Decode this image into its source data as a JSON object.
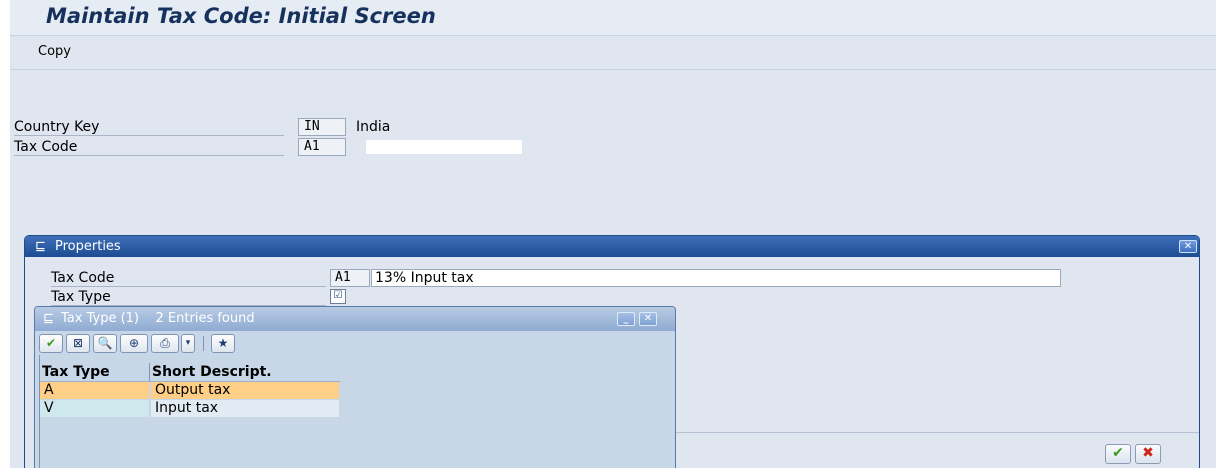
{
  "screen": {
    "title": "Maintain Tax Code: Initial Screen",
    "toolbar": {
      "copy_label": "Copy"
    },
    "fields": {
      "country_key": {
        "label": "Country Key",
        "value": "IN",
        "description": "India"
      },
      "tax_code": {
        "label": "Tax Code",
        "value": "A1",
        "description": ""
      }
    }
  },
  "properties_dialog": {
    "title": "Properties",
    "tax_code": {
      "label": "Tax Code",
      "value": "A1",
      "description": "13% Input tax"
    },
    "tax_type": {
      "label": "Tax Type",
      "value": ""
    }
  },
  "taxtype_popup": {
    "title": "Tax Type (1)",
    "entries_found": "2 Entries found",
    "columns": [
      "Tax Type",
      "Short Descript."
    ],
    "rows": [
      {
        "tax_type": "A",
        "short_description": "Output tax",
        "selected": true
      },
      {
        "tax_type": "V",
        "short_description": "Input tax",
        "selected": false
      }
    ],
    "toolbar_icons": [
      "check-icon",
      "cancel-selection-icon",
      "find-icon",
      "find-next-icon",
      "print-icon",
      "dropdown-icon",
      "personal-list-icon"
    ]
  },
  "colors": {
    "title_text": "#16325c",
    "dialog_title_bar": "#1d4c93",
    "selected_row": "#ffcf87",
    "ok_green": "#3d9a1b",
    "cancel_red": "#c92a1c"
  }
}
